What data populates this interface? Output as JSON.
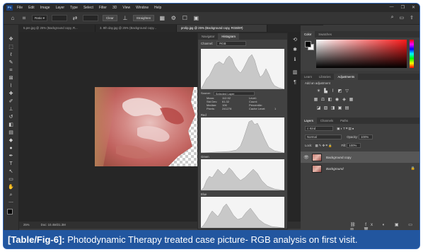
{
  "app": {
    "logo": "Ps",
    "menu": [
      "File",
      "Edit",
      "Image",
      "Layer",
      "Type",
      "Select",
      "Filter",
      "3D",
      "View",
      "Window",
      "Help"
    ],
    "window_controls": [
      "—",
      "❐",
      "✕"
    ]
  },
  "options_bar": {
    "radius_label": "Ratio",
    "clear_label": "Clear",
    "straighten_label": "Straighten"
  },
  "tabs": [
    {
      "label": "5.pre.jpg @ 25% (Background copy, R...",
      "active": false
    },
    {
      "label": "3. 8th day.jpg @ 25% (Background copy...",
      "active": false
    },
    {
      "label": "prolip.jpg @ 25% (Background copy, RGB/8#)",
      "active": true
    }
  ],
  "status_bar": {
    "zoom": "25%",
    "doc": "Doc: 10.4M/21.3M"
  },
  "histogram_panel": {
    "tabs": [
      "Navigator",
      "Histogram"
    ],
    "active_tab": "Histogram",
    "channel_label": "Channel:",
    "channel_value": "RGB",
    "source_label": "Source:",
    "source_value": "Selected Layer",
    "stats_left_labels": [
      "Mean:",
      "Std Dev:",
      "Median:",
      "Pixels:"
    ],
    "stats_left_values": [
      "112.52",
      "61.32",
      "106",
      "241278"
    ],
    "stats_right_labels": [
      "Level:",
      "Count:",
      "Percentile:",
      "Cache Level:"
    ],
    "stats_right_values": [
      "",
      "",
      "",
      "1"
    ],
    "channels": [
      "Red",
      "Green",
      "Blue"
    ]
  },
  "color_panel": {
    "tabs": [
      "Color",
      "Swatches"
    ],
    "active_tab": "Color",
    "foreground": "#000000",
    "background": "#ffffff"
  },
  "adjustments_panel": {
    "tabs": [
      "Learn",
      "Libraries",
      "Adjustments"
    ],
    "active_tab": "Adjustments",
    "title": "Add an adjustment"
  },
  "layers_panel": {
    "tabs": [
      "Layers",
      "Channels",
      "Paths"
    ],
    "active_tab": "Layers",
    "kind_label": "Kind",
    "blend_mode": "Normal",
    "opacity_label": "Opacity:",
    "opacity_value": "100%",
    "lock_label": "Lock:",
    "fill_label": "Fill:",
    "fill_value": "100%",
    "layers": [
      {
        "name": "Background copy",
        "selected": true,
        "visible": true
      },
      {
        "name": "Background",
        "selected": false,
        "visible": false
      }
    ]
  },
  "caption": {
    "label": "[Table/Fig-6]:",
    "text": "Photodynamic Therapy treated case picture- RGB analysis on first visit."
  },
  "colors": {
    "accent": "#22569f",
    "app_bg": "#3c3c3c"
  }
}
